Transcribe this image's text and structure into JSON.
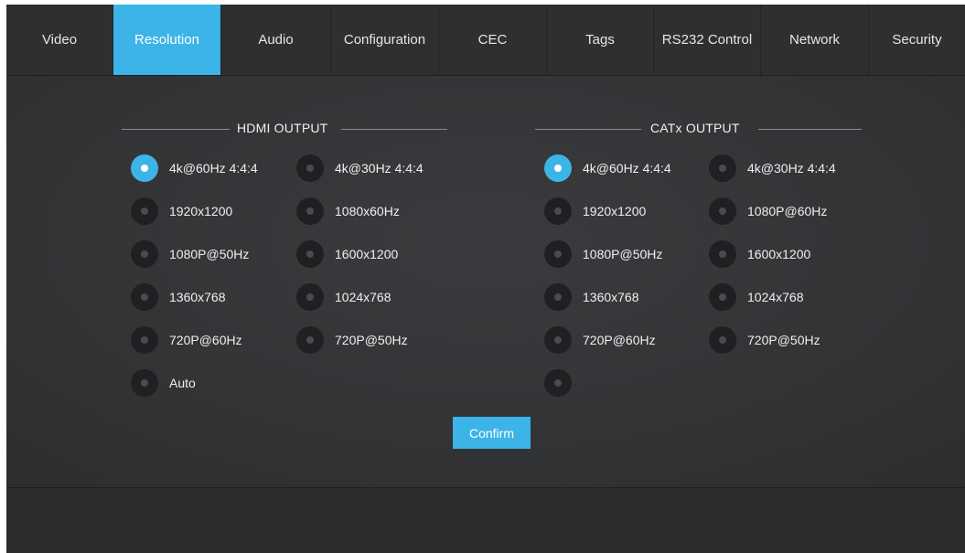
{
  "tabs": [
    {
      "label": "Video",
      "active": false
    },
    {
      "label": "Resolution",
      "active": true
    },
    {
      "label": "Audio",
      "active": false
    },
    {
      "label": "Configuration",
      "active": false
    },
    {
      "label": "CEC",
      "active": false
    },
    {
      "label": "Tags",
      "active": false
    },
    {
      "label": "RS232 Control",
      "active": false
    },
    {
      "label": "Network",
      "active": false
    },
    {
      "label": "Security",
      "active": false
    }
  ],
  "hdmi": {
    "title": "HDMI OUTPUT",
    "selected": "4k@60Hz 4:4:4",
    "options": [
      "4k@60Hz 4:4:4",
      "4k@30Hz 4:4:4",
      "1920x1200",
      "1080x60Hz",
      "1080P@50Hz",
      "1600x1200",
      "1360x768",
      "1024x768",
      "720P@60Hz",
      "720P@50Hz",
      "Auto"
    ]
  },
  "catx": {
    "title": "CATx  OUTPUT",
    "selected": "4k@60Hz 4:4:4",
    "options": [
      "4k@60Hz 4:4:4",
      "4k@30Hz 4:4:4",
      "1920x1200",
      "1080P@60Hz",
      "1080P@50Hz",
      "1600x1200",
      "1360x768",
      "1024x768",
      "720P@60Hz",
      "720P@50Hz",
      ""
    ]
  },
  "confirm_label": "Confirm",
  "colors": {
    "accent": "#3cb4e8",
    "background": "#2b2c2e"
  }
}
